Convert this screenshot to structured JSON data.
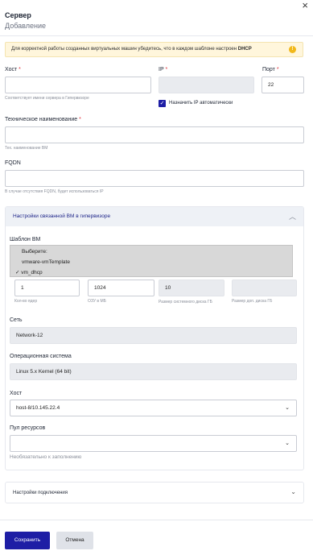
{
  "header": {
    "title": "Сервер",
    "subtitle": "Добавление",
    "close_glyph": "×"
  },
  "alert": {
    "text": "Для корректной работы созданных виртуальных машин убедитесь, что в каждом шаблоне настроен ",
    "bold": "DHCP",
    "icon": "!"
  },
  "host": {
    "label": "Хост",
    "value": "",
    "hint": "Соответствует имени сервера в Гипервизоре"
  },
  "ip": {
    "label": "IP",
    "value": ""
  },
  "port": {
    "label": "Порт",
    "value": "22"
  },
  "auto_ip": {
    "checked": true,
    "label": "Назначить IP автоматически"
  },
  "tech_name": {
    "label": "Техническое наименование",
    "value": "",
    "hint": "Тех. наименование ВМ"
  },
  "fqdn": {
    "label": "FQDN",
    "value": "",
    "hint": "В случае отсутствия FQDN, будет использоваться IP"
  },
  "vm_section": {
    "title": "Настройки связанной ВМ в гипервизоре",
    "template_label": "Шаблон ВМ",
    "template_options": [
      "Выберите:",
      "vmware-vmTemplate",
      "vm_dhcp"
    ],
    "selected_template": "vm_dhcp",
    "cpu": {
      "value": "1",
      "hint": "Кол-во ядер"
    },
    "ram": {
      "value": "1024",
      "hint": "ОЗУ в МБ"
    },
    "sys_disk": {
      "value": "10",
      "hint": "Размер системного диска ГБ"
    },
    "extra_disk": {
      "value": "",
      "hint": "Размер доп. диска ГБ"
    },
    "network": {
      "label": "Сеть",
      "value": "Network-12"
    },
    "os": {
      "label": "Операционная система",
      "value": "Linux 5.x Kernel (64 bit)"
    },
    "vm_host": {
      "label": "Хост",
      "value": "host-8/10.145.22.4"
    },
    "pool": {
      "label": "Пул ресурсов",
      "value": "",
      "hint": "Необязательно к заполнению"
    }
  },
  "conn_section": {
    "title": "Настройки подключения"
  },
  "buttons": {
    "save": "Сохранить",
    "cancel": "Отмена"
  },
  "colors": {
    "accent": "#1e1ea5",
    "alert_bg": "#fff6dc",
    "warning": "#f1b81a",
    "required": "#e0323a"
  }
}
